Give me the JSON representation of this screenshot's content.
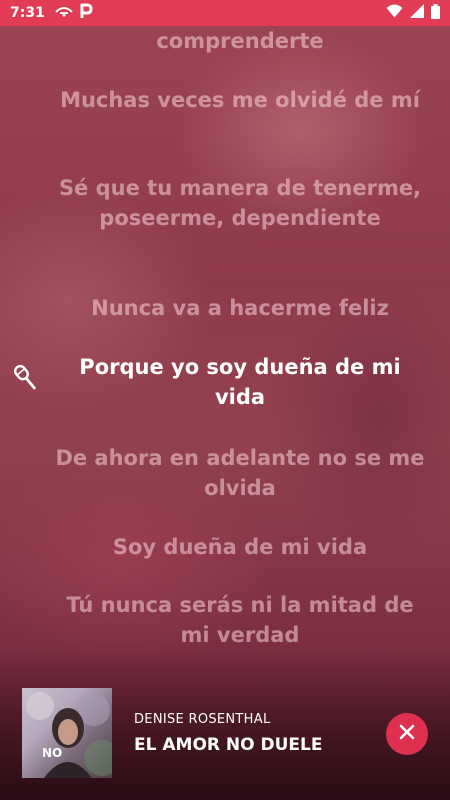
{
  "status_bar": {
    "time": "7:31",
    "left_icons": [
      "cast-icon",
      "p-app-icon"
    ],
    "right_icons": [
      "wifi-icon",
      "cell-signal-icon",
      "battery-icon"
    ],
    "background_color": "#e23b55"
  },
  "lyrics": {
    "lines": [
      {
        "text": "comprenderte",
        "active": false
      },
      {
        "text": "Muchas veces me olvidé de mí",
        "active": false
      },
      {
        "text": "Sé que tu manera de tenerme, poseerme, dependiente",
        "active": false
      },
      {
        "text": "Nunca va a hacerme feliz",
        "active": false
      },
      {
        "text": "Porque yo soy dueña de mi vida",
        "active": true
      },
      {
        "text": "De ahora en adelante no se me olvida",
        "active": false
      },
      {
        "text": "Soy dueña de mi vida",
        "active": false
      },
      {
        "text": "Tú nunca serás ni la mitad de mi verdad",
        "active": false
      }
    ]
  },
  "side_controls": {
    "mic_icon": "microphone-icon"
  },
  "player": {
    "cover_text": "NO",
    "artist": "DENISE ROSENTHAL",
    "track_title": "EL AMOR NO DUELE",
    "close_icon": "close-icon",
    "accent_color": "#e0304f"
  }
}
